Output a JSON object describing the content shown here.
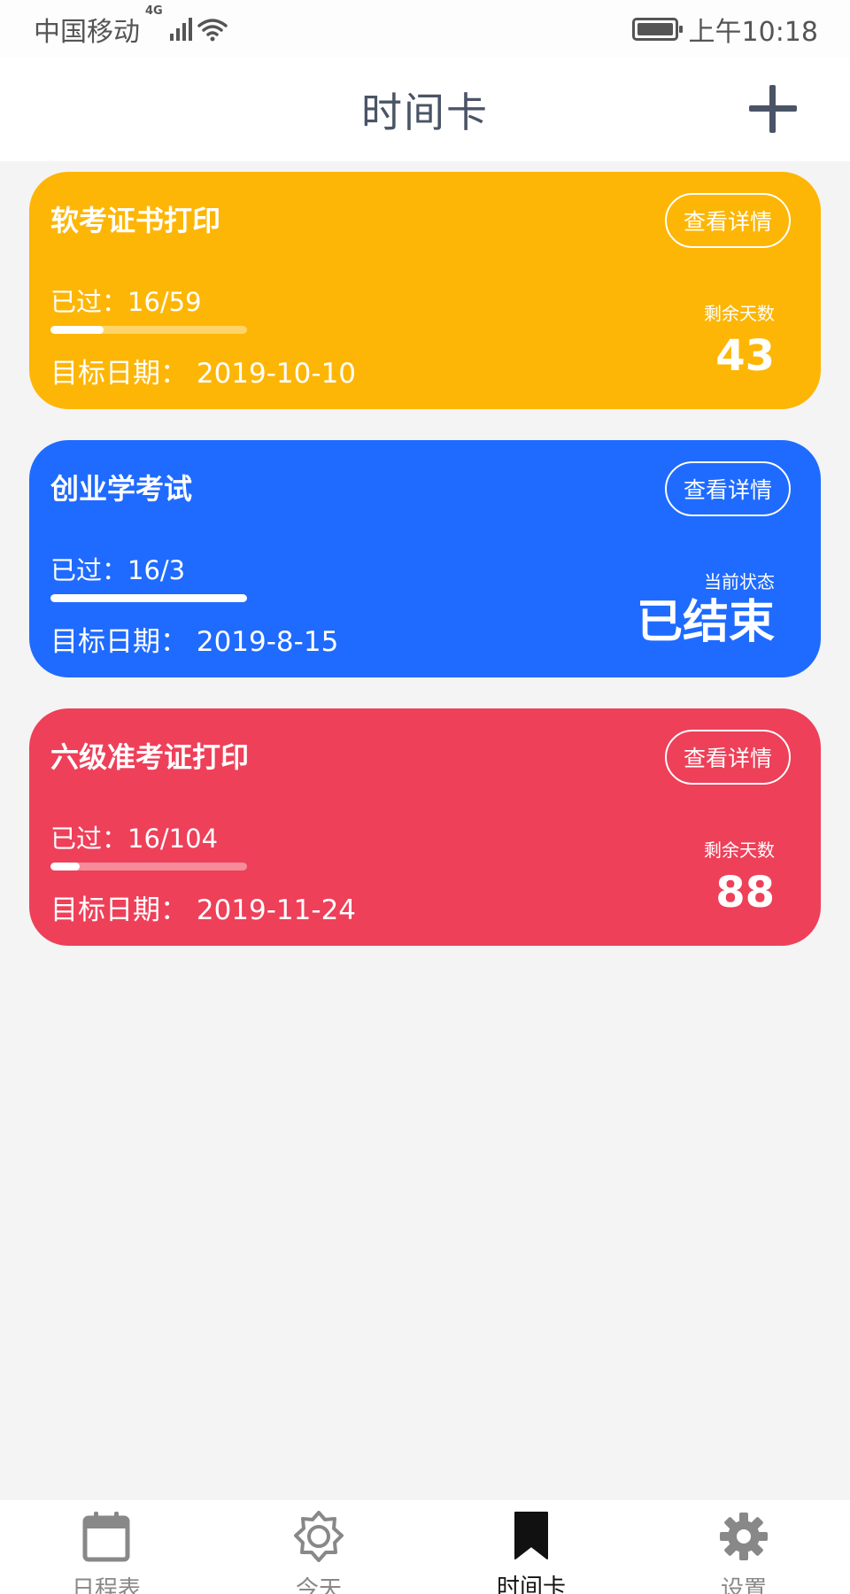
{
  "status_bar": {
    "carrier": "中国移动",
    "network": "4G",
    "time": "上午10:18"
  },
  "header": {
    "title": "时间卡",
    "add_icon": "plus-icon"
  },
  "cards": [
    {
      "title": "软考证书打印",
      "detail_button": "查看详情",
      "passed": "已过：16/59",
      "progress": 0.27,
      "target": "目标日期：  2019-10-10",
      "side_label": "剩余天数",
      "side_value": "43",
      "color": "#FDB606"
    },
    {
      "title": "创业学考试",
      "detail_button": "查看详情",
      "passed": "已过：16/3",
      "progress": 1.0,
      "target": "目标日期：  2019-8-15",
      "side_label": "当前状态",
      "side_value": "已结束",
      "color": "#1F6BFF"
    },
    {
      "title": "六级准考证打印",
      "detail_button": "查看详情",
      "passed": "已过：16/104",
      "progress": 0.15,
      "target": "目标日期：  2019-11-24",
      "side_label": "剩余天数",
      "side_value": "88",
      "color": "#EE4059"
    }
  ],
  "tabs": [
    {
      "label": "日程表",
      "icon": "calendar-icon",
      "active": false
    },
    {
      "label": "今天",
      "icon": "sun-icon",
      "active": false
    },
    {
      "label": "时间卡",
      "icon": "bookmark-icon",
      "active": true
    },
    {
      "label": "设置",
      "icon": "gear-icon",
      "active": false
    }
  ]
}
